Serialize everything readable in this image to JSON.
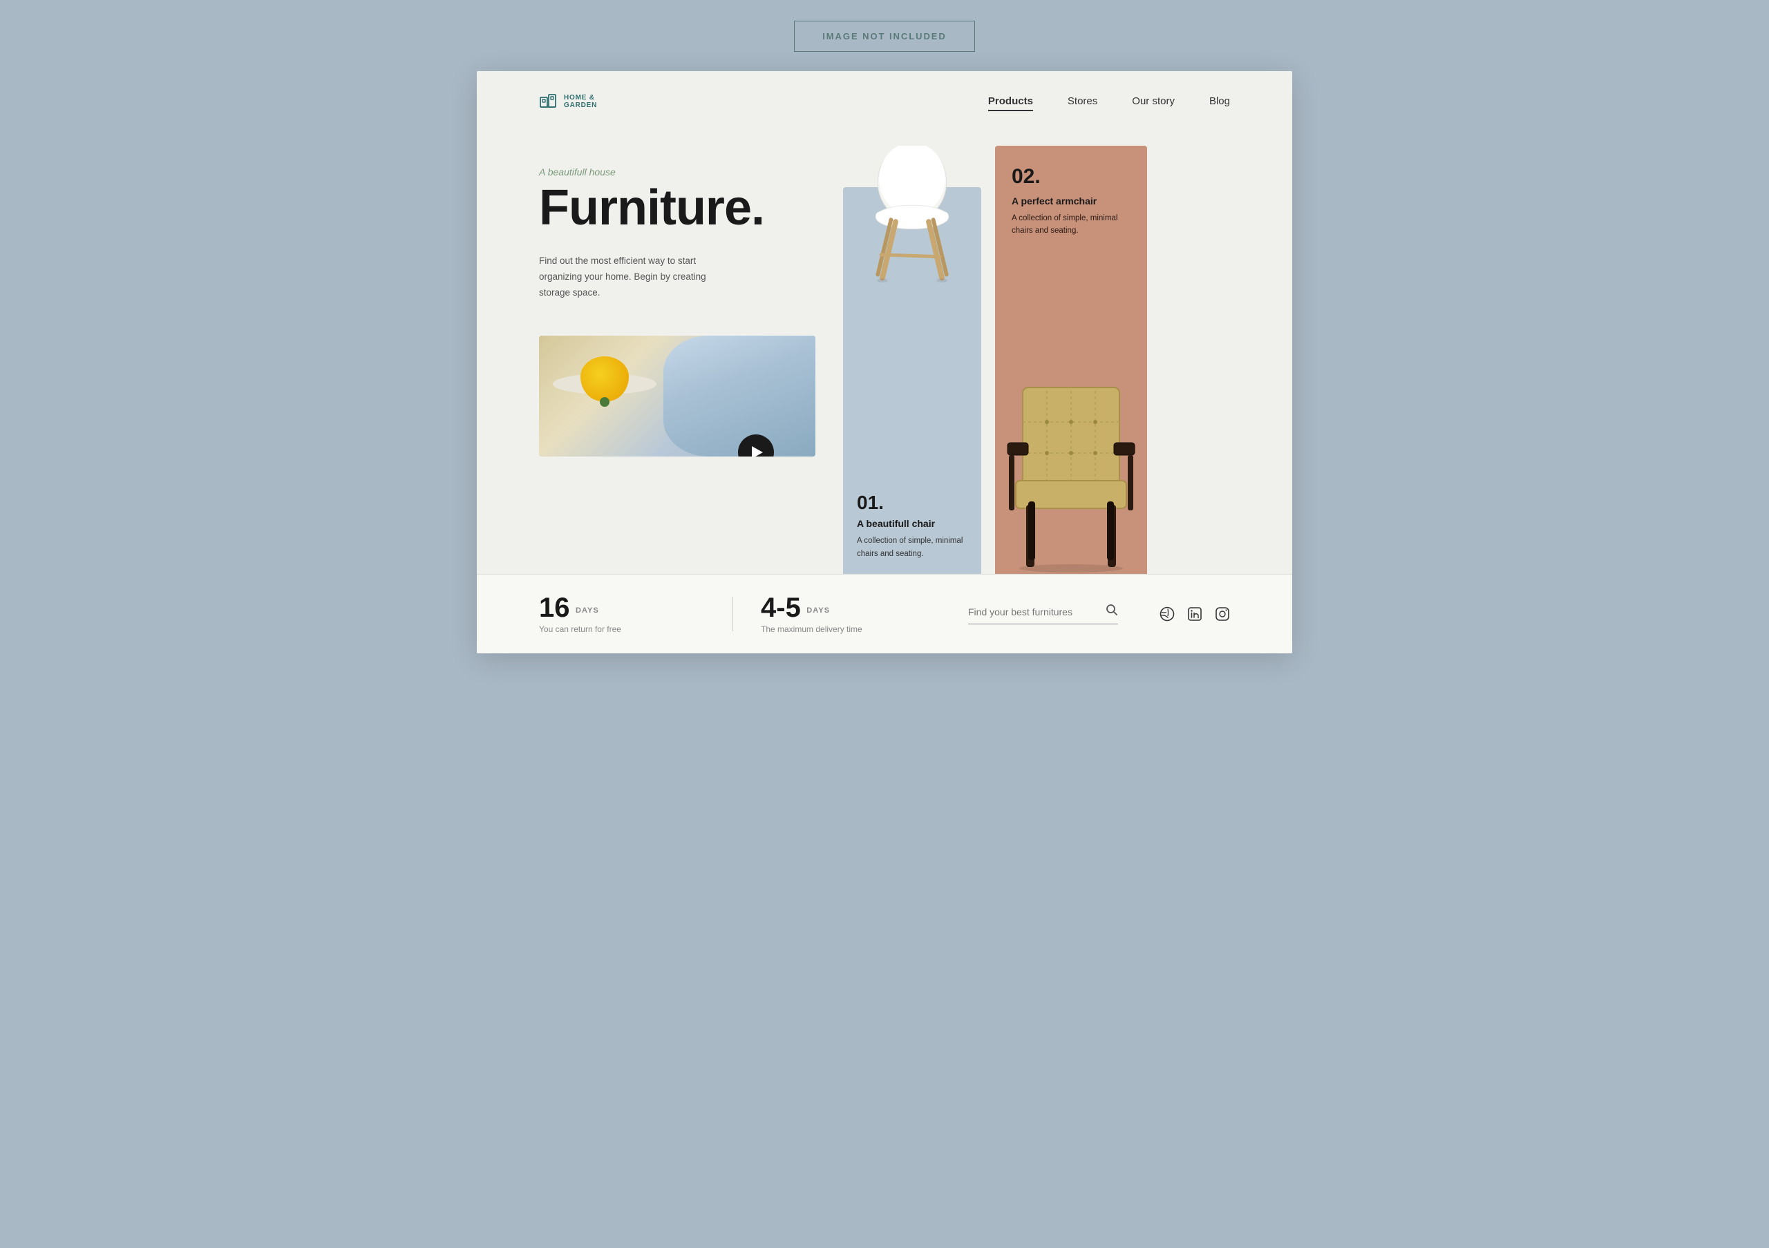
{
  "image_not_included": "IMAGE NOT INCLUDED",
  "logo": {
    "text_line1": "HOME &",
    "text_line2": "GARDEN"
  },
  "nav": {
    "items": [
      {
        "label": "Products",
        "active": true
      },
      {
        "label": "Stores",
        "active": false
      },
      {
        "label": "Our story",
        "active": false
      },
      {
        "label": "Blog",
        "active": false
      }
    ]
  },
  "hero": {
    "subtitle": "A beautifull house",
    "title": "Furniture.",
    "description": "Find out the most efficient way to start organizing your home. Begin by creating storage space."
  },
  "card1": {
    "number": "01.",
    "title": "A beautifull chair",
    "description": "A collection of simple, minimal chairs and seating."
  },
  "card2": {
    "number": "02.",
    "title": "A perfect armchair",
    "description": "A collection of simple, minimal chairs and seating."
  },
  "footer": {
    "stat1_number": "16",
    "stat1_unit": "DAYS",
    "stat1_label": "You can return for free",
    "stat2_number": "4-5",
    "stat2_unit": "DAYS",
    "stat2_label": "The maximum delivery time",
    "search_placeholder": "Find your best furnitures"
  }
}
